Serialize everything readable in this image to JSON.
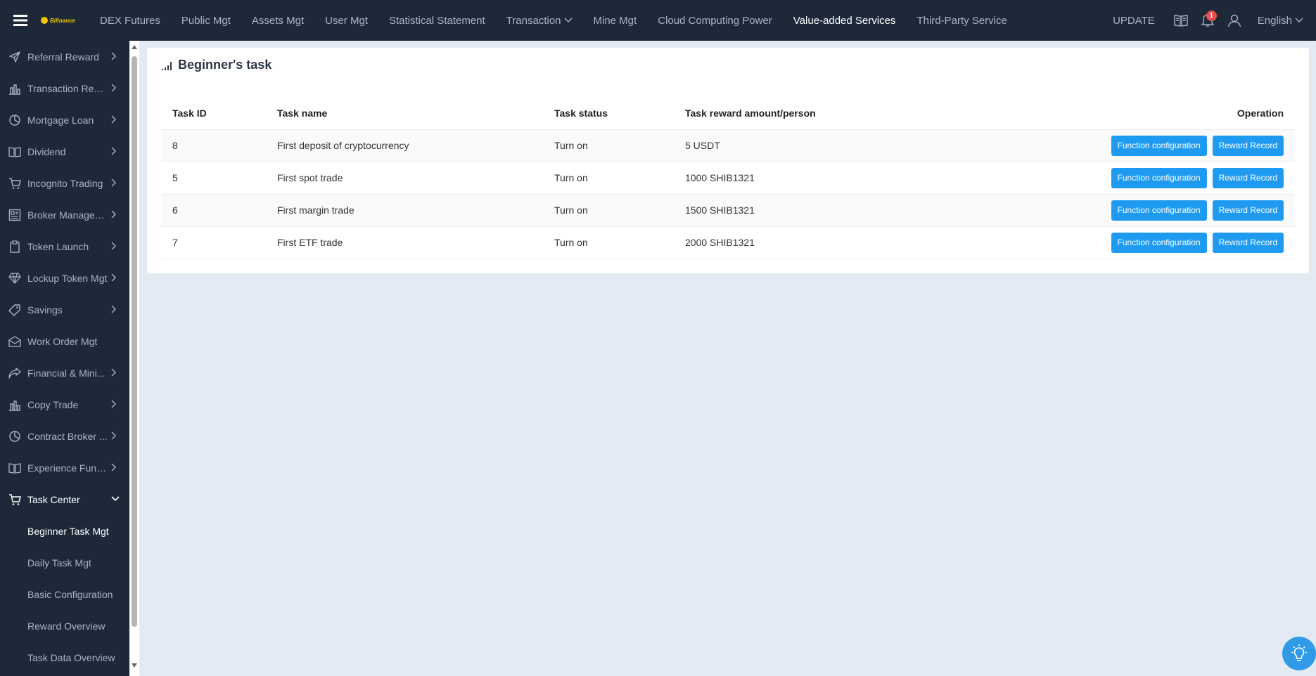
{
  "topbar": {
    "logo_text": "Bifinance",
    "nav": [
      {
        "label": "DEX Futures"
      },
      {
        "label": "Public Mgt"
      },
      {
        "label": "Assets Mgt"
      },
      {
        "label": "User Mgt"
      },
      {
        "label": "Statistical Statement"
      },
      {
        "label": "Transaction"
      },
      {
        "label": "Mine Mgt"
      },
      {
        "label": "Cloud Computing Power"
      },
      {
        "label": "Value-added Services"
      },
      {
        "label": "Third-Party Service"
      }
    ],
    "update_label": "UPDATE",
    "notification_count": "1",
    "language": "English"
  },
  "sidebar": {
    "items": [
      {
        "label": "Referral Reward",
        "icon": "send-icon"
      },
      {
        "label": "Transaction Rewa...",
        "icon": "bar-chart-icon"
      },
      {
        "label": "Mortgage Loan",
        "icon": "pie-chart-icon"
      },
      {
        "label": "Dividend",
        "icon": "book-icon"
      },
      {
        "label": "Incognito Trading",
        "icon": "cart-icon"
      },
      {
        "label": "Broker Managem...",
        "icon": "grid-icon"
      },
      {
        "label": "Token Launch",
        "icon": "clipboard-icon"
      },
      {
        "label": "Lockup Token Mgt",
        "icon": "diamond-icon"
      },
      {
        "label": "Savings",
        "icon": "tag-icon"
      },
      {
        "label": "Work Order Mgt",
        "icon": "envelope-icon"
      },
      {
        "label": "Financial & Mini...",
        "icon": "share-icon"
      },
      {
        "label": "Copy Trade",
        "icon": "bar-chart-icon"
      },
      {
        "label": "Contract Broker ...",
        "icon": "pie-chart-icon"
      },
      {
        "label": "Experience Fundi...",
        "icon": "book-icon"
      }
    ],
    "open_item": {
      "label": "Task Center",
      "icon": "cart-icon"
    },
    "sub_items": [
      {
        "label": "Beginner Task Mgt"
      },
      {
        "label": "Daily Task Mgt"
      },
      {
        "label": "Basic Configuration"
      },
      {
        "label": "Reward Overview"
      },
      {
        "label": "Task Data Overview"
      }
    ]
  },
  "card": {
    "title": "Beginner's task",
    "columns": {
      "id": "Task ID",
      "name": "Task name",
      "status": "Task status",
      "reward": "Task reward amount/person",
      "operation": "Operation"
    },
    "rows": [
      {
        "id": "8",
        "name": "First deposit of cryptocurrency",
        "status": "Turn on",
        "reward": "5 USDT"
      },
      {
        "id": "5",
        "name": "First spot trade",
        "status": "Turn on",
        "reward": "1000 SHIB1321"
      },
      {
        "id": "6",
        "name": "First margin trade",
        "status": "Turn on",
        "reward": "1500 SHIB1321"
      },
      {
        "id": "7",
        "name": "First ETF trade",
        "status": "Turn on",
        "reward": "2000 SHIB1321"
      }
    ],
    "buttons": {
      "config": "Function configuration",
      "record": "Reward Record"
    }
  },
  "colors": {
    "topbar_bg": "#1d2939",
    "page_bg": "#e4eaf4",
    "accent_button": "#1e9bf0",
    "badge": "#f04b4b"
  }
}
